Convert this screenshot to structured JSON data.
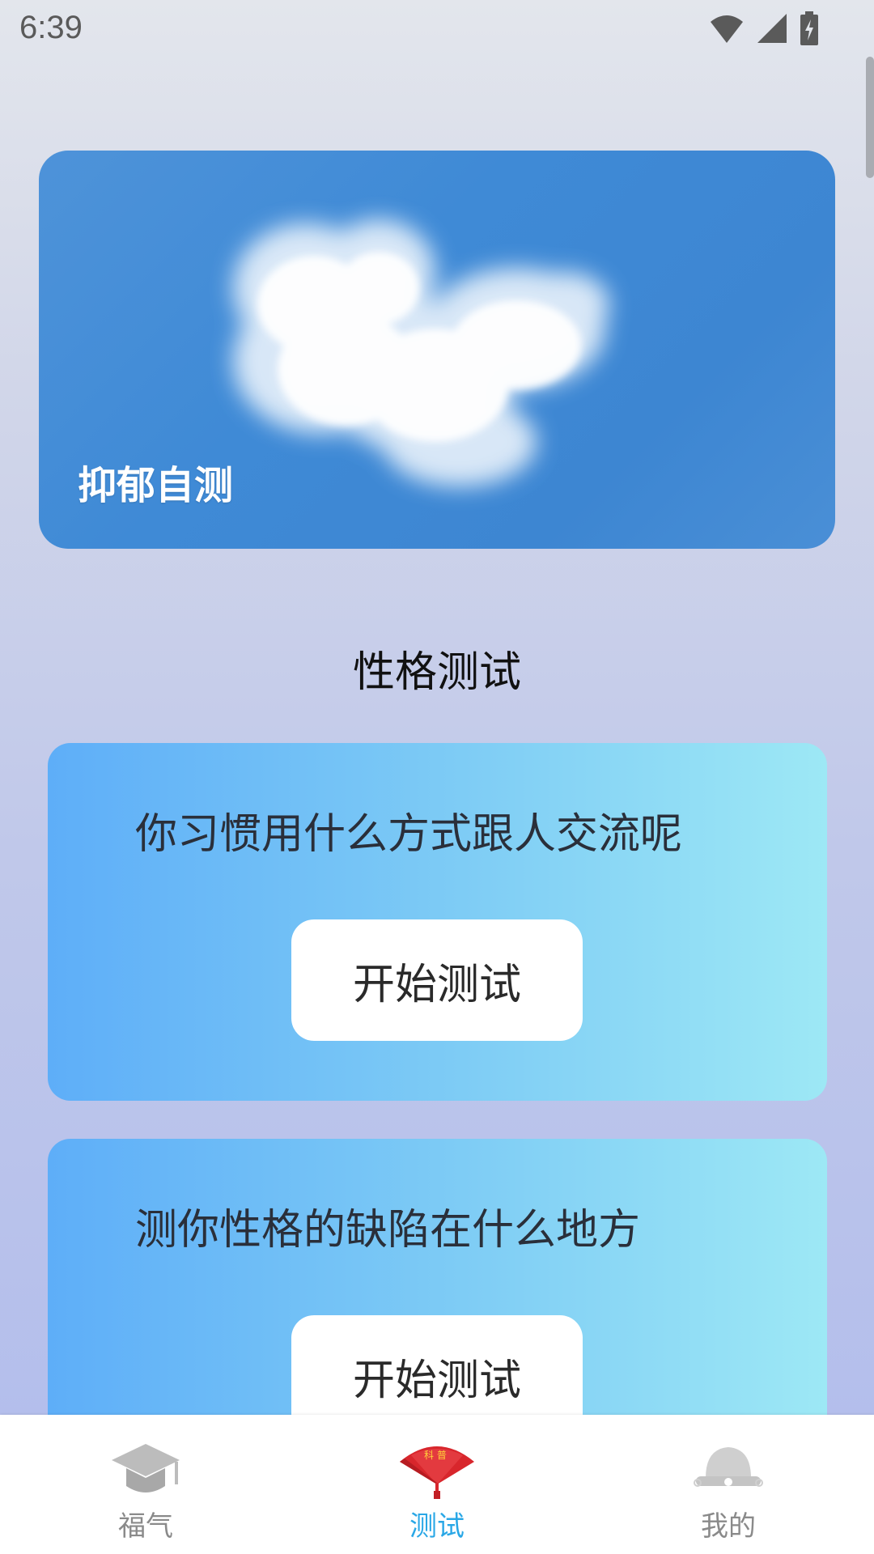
{
  "status": {
    "time": "6:39"
  },
  "banner": {
    "label": "抑郁自测"
  },
  "section": {
    "title": "性格测试"
  },
  "cards": [
    {
      "question": "你习惯用什么方式跟人交流呢",
      "button": "开始测试"
    },
    {
      "question": "测你性格的缺陷在什么地方",
      "button": "开始测试"
    }
  ],
  "nav": {
    "items": [
      {
        "label": "福气",
        "icon": "graduation-cap-icon",
        "active": false
      },
      {
        "label": "测试",
        "icon": "folding-fan-icon",
        "active": true,
        "fan_text": "科 普"
      },
      {
        "label": "我的",
        "icon": "rice-bowl-icon",
        "active": false
      }
    ],
    "active_color": "#29a7e6",
    "inactive_color": "#8a8a8a"
  }
}
